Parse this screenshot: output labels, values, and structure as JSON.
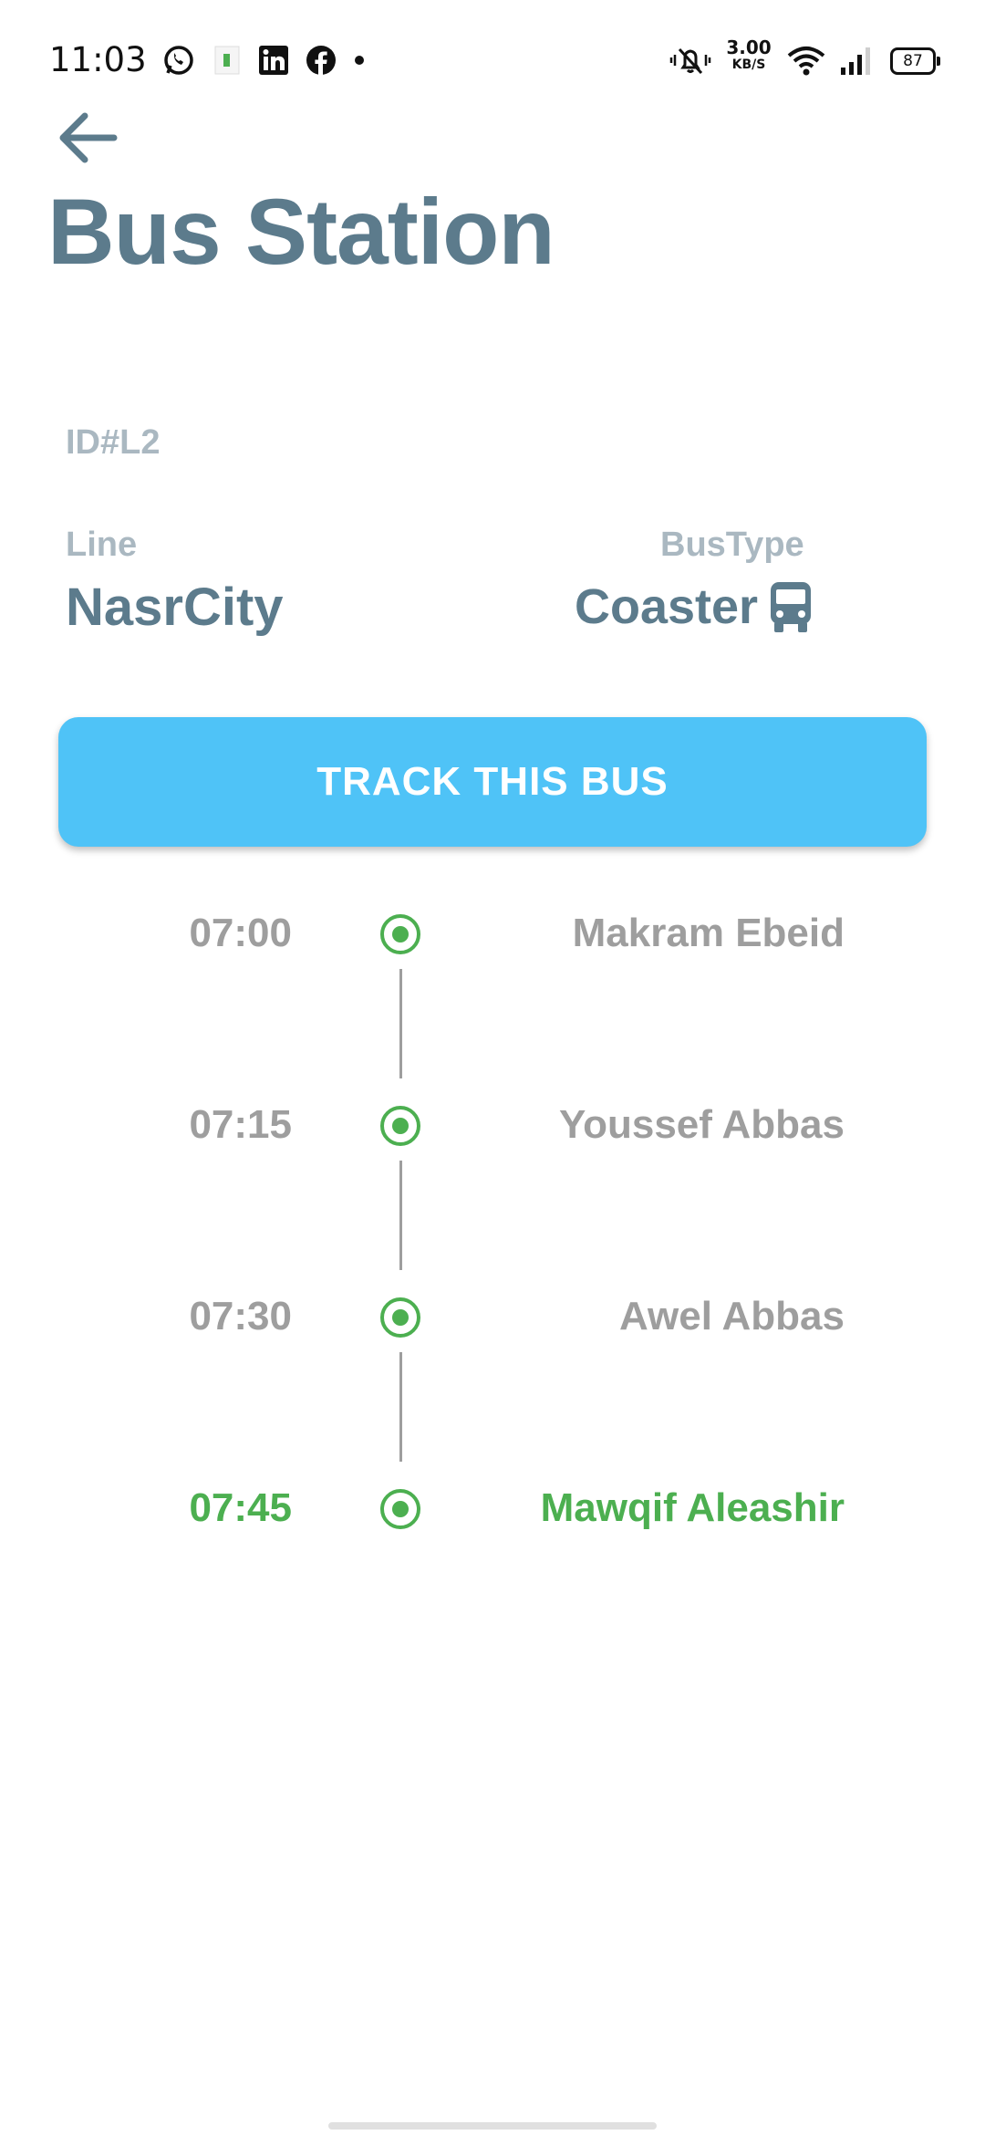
{
  "status_bar": {
    "time": "11:03",
    "net_speed_value": "3.00",
    "net_speed_unit": "KB/S",
    "battery": "87",
    "icons": [
      "whatsapp-icon",
      "app-notification-icon",
      "linkedin-icon",
      "facebook-icon",
      "dot-icon",
      "mute-vibrate-icon",
      "wifi-icon",
      "signal-icon",
      "battery-icon"
    ]
  },
  "header": {
    "title": "Bus Station",
    "back_icon": "arrow-left-icon"
  },
  "bus": {
    "id": "ID#L2",
    "line_label": "Line",
    "line_value": "NasrCity",
    "bustype_label": "BusType",
    "bustype_value": "Coaster",
    "bustype_icon": "bus-icon"
  },
  "track_button": {
    "label": "TRACK THIS BUS"
  },
  "stops": [
    {
      "time": "07:00",
      "name": "Makram Ebeid",
      "active": false
    },
    {
      "time": "07:15",
      "name": "Youssef Abbas",
      "active": false
    },
    {
      "time": "07:30",
      "name": "Awel Abbas",
      "active": false
    },
    {
      "time": "07:45",
      "name": "Mawqif Aleashir",
      "active": true
    }
  ],
  "colors": {
    "primary_text": "#5c7b8c",
    "secondary_text": "#aab8c1",
    "button": "#4fc3f7",
    "stop_inactive": "#9e9e9e",
    "stop_active": "#4caf50"
  }
}
